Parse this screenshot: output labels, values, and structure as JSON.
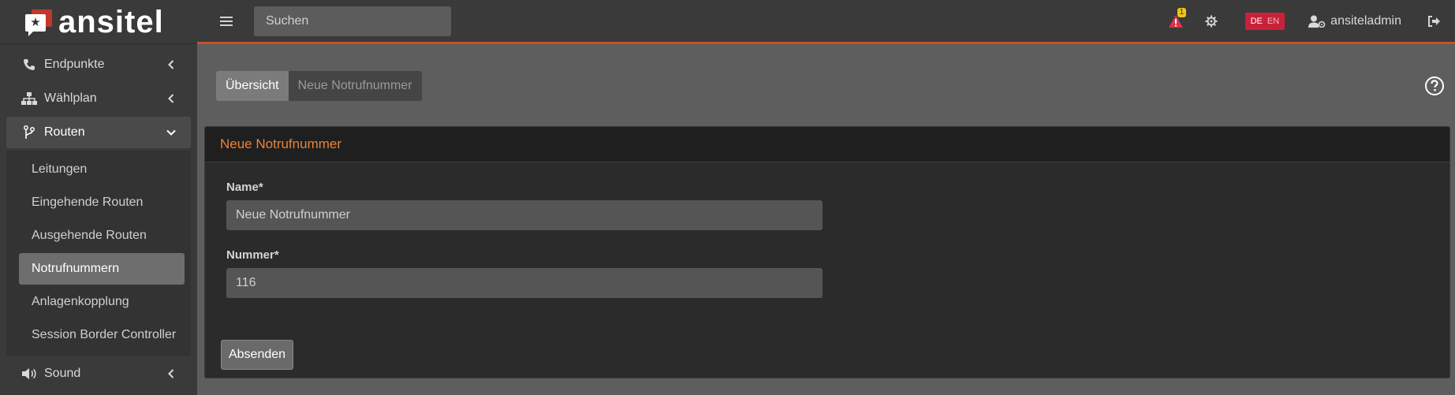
{
  "brand": {
    "name": "ansitel",
    "mark_glyph": "★"
  },
  "topbar": {
    "search_placeholder": "Suchen",
    "alert_count": "1",
    "lang_active": "DE",
    "lang_inactive": "EN",
    "username": "ansiteladmin"
  },
  "sidebar": {
    "items": [
      {
        "label": "Endpunkte",
        "icon": "phone-icon"
      },
      {
        "label": "Wählplan",
        "icon": "sitemap-icon"
      },
      {
        "label": "Routen",
        "icon": "code-branch-icon"
      },
      {
        "label": "Sound",
        "icon": "volume-icon"
      }
    ],
    "routen_sub": [
      {
        "label": "Leitungen"
      },
      {
        "label": "Eingehende Routen"
      },
      {
        "label": "Ausgehende Routen"
      },
      {
        "label": "Notrufnummern"
      },
      {
        "label": "Anlagenkopplung"
      },
      {
        "label": "Session Border Controller"
      }
    ]
  },
  "breadcrumb": {
    "first": "Übersicht",
    "second": "Neue Notrufnummer"
  },
  "card": {
    "title": "Neue Notrufnummer",
    "name_label": "Name*",
    "name_value": "Neue Notrufnummer",
    "number_label": "Nummer*",
    "number_value": "116",
    "submit_label": "Absenden"
  },
  "colors": {
    "accent": "#e8843a",
    "topbar_border": "#c0532b",
    "lang_badge": "#c8223a",
    "alert": "#d9334a"
  }
}
